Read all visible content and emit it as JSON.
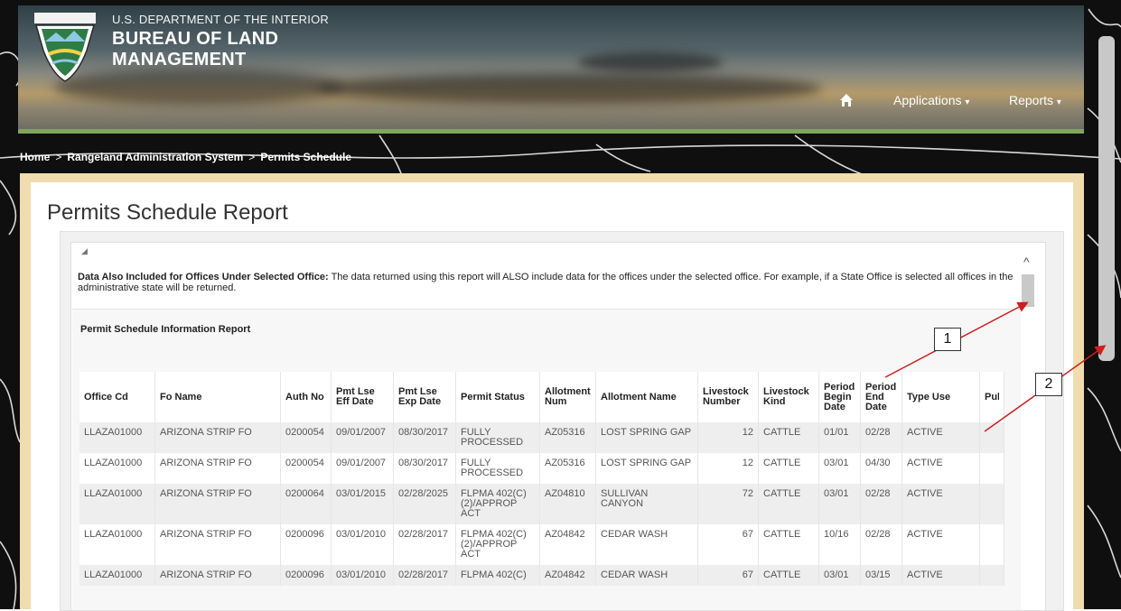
{
  "header": {
    "department": "U.S. DEPARTMENT OF THE INTERIOR",
    "bureau_line1": "BUREAU OF LAND",
    "bureau_line2": "MANAGEMENT",
    "nav_home_icon": "home-icon",
    "nav_applications": "Applications",
    "nav_reports": "Reports",
    "dropdown_caret": "▾"
  },
  "breadcrumb": {
    "home": "Home",
    "rangeland": "Rangeland Administration System",
    "current": "Permits Schedule",
    "separator": ">"
  },
  "page": {
    "title": "Permits Schedule Report"
  },
  "notice": {
    "bold": "Data Also Included for Offices Under Selected Office:",
    "text": " The data returned using this report will ALSO include data for the offices under the selected office. For example, if a State Office is selected all offices in the administrative state will be returned."
  },
  "report": {
    "subtitle": "Permit Schedule Information Report",
    "columns": [
      "Office Cd",
      "Fo Name",
      "Auth No",
      "Pmt Lse Eff Date",
      "Pmt Lse Exp Date",
      "Permit Status",
      "Allotment Num",
      "Allotment Name",
      "Livestock Number",
      "Livestock Kind",
      "Period Begin Date",
      "Period End Date",
      "Type Use",
      "Pul Lse Pct"
    ],
    "rows": [
      [
        "LLAZA01000",
        "ARIZONA STRIP FO",
        "0200054",
        "09/01/2007",
        "08/30/2017",
        "FULLY PROCESSED",
        "AZ05316",
        "LOST SPRING GAP",
        "12",
        "CATTLE",
        "01/01",
        "02/28",
        "ACTIVE",
        ""
      ],
      [
        "LLAZA01000",
        "ARIZONA STRIP FO",
        "0200054",
        "09/01/2007",
        "08/30/2017",
        "FULLY PROCESSED",
        "AZ05316",
        "LOST SPRING GAP",
        "12",
        "CATTLE",
        "03/01",
        "04/30",
        "ACTIVE",
        ""
      ],
      [
        "LLAZA01000",
        "ARIZONA STRIP FO",
        "0200064",
        "03/01/2015",
        "02/28/2025",
        "FLPMA 402(C)(2)/APPROP ACT",
        "AZ04810",
        "SULLIVAN CANYON",
        "72",
        "CATTLE",
        "03/01",
        "02/28",
        "ACTIVE",
        ""
      ],
      [
        "LLAZA01000",
        "ARIZONA STRIP FO",
        "0200096",
        "03/01/2010",
        "02/28/2017",
        "FLPMA 402(C)(2)/APPROP ACT",
        "AZ04842",
        "CEDAR WASH",
        "67",
        "CATTLE",
        "10/16",
        "02/28",
        "ACTIVE",
        ""
      ],
      [
        "LLAZA01000",
        "ARIZONA STRIP FO",
        "0200096",
        "03/01/2010",
        "02/28/2017",
        "FLPMA 402(C)",
        "AZ04842",
        "CEDAR WASH",
        "67",
        "CATTLE",
        "03/01",
        "03/15",
        "ACTIVE",
        ""
      ]
    ]
  },
  "callouts": {
    "one": "1",
    "two": "2"
  },
  "scroll_up_glyph": "^",
  "collapse_glyph": "◢"
}
